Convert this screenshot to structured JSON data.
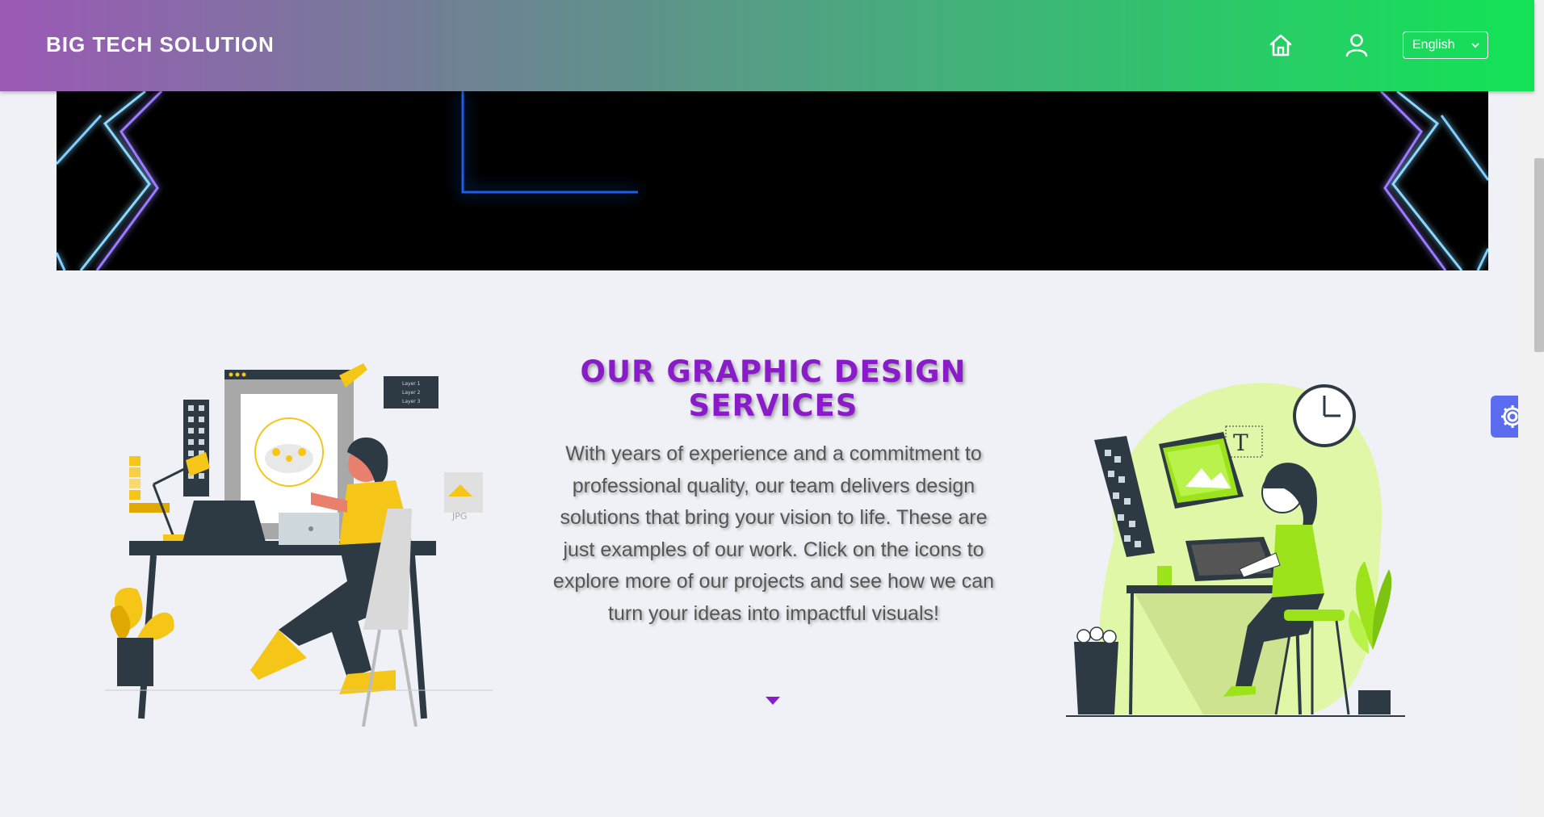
{
  "header": {
    "brand": "BIG TECH SOLUTION",
    "language": "English",
    "home_icon": "home-icon",
    "user_icon": "user-icon"
  },
  "section": {
    "title": "OUR GRAPHIC DESIGN SERVICES",
    "description": "With years of experience and a commitment to professional quality, our team delivers design solutions that bring your vision to life. These are just examples of our work. Click on the icons to explore more of our projects and see how we can turn your ideas into impactful visuals!"
  },
  "illustrations": {
    "left_badge": "JPG",
    "left_layers": [
      "Layer 1",
      "Layer 2",
      "Layer 3"
    ],
    "right_glyph": "T"
  },
  "colors": {
    "title": "#8a1bc9",
    "header_start": "#9b59b6",
    "header_end": "#12e356",
    "settings": "#5b6cf0"
  }
}
